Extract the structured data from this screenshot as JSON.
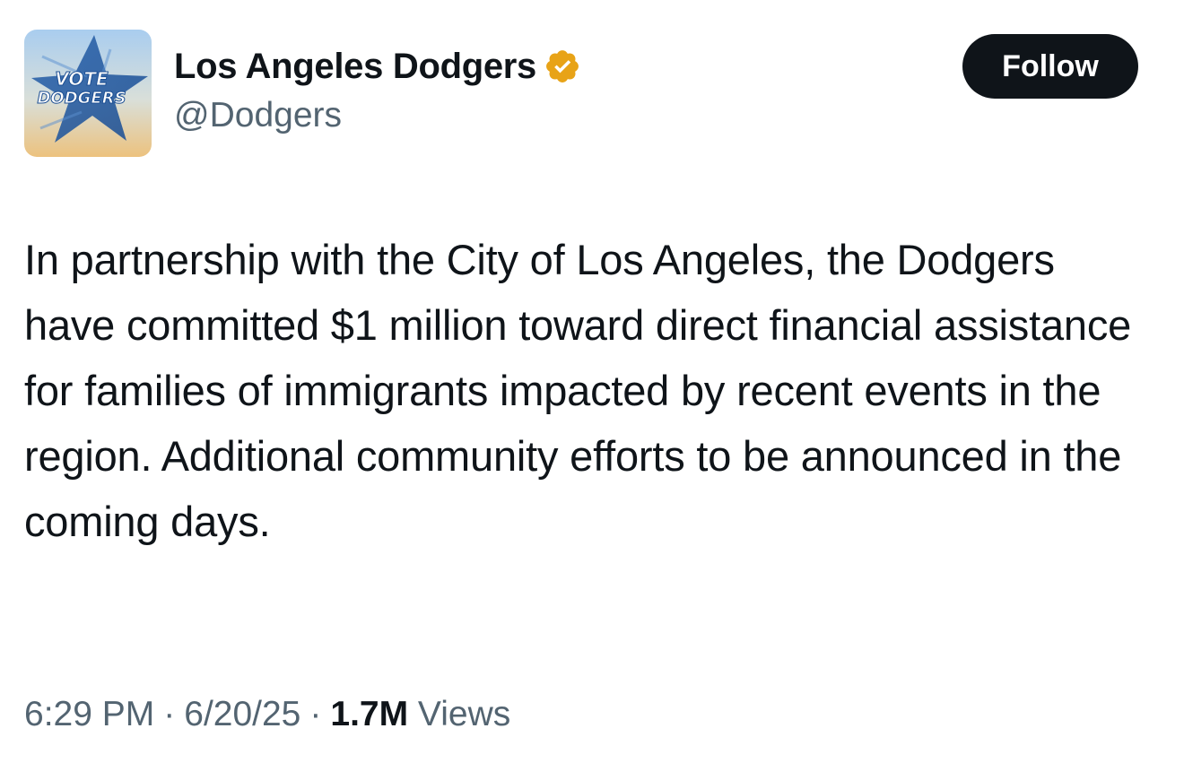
{
  "author": {
    "display_name": "Los Angeles Dodgers",
    "handle": "@Dodgers",
    "verified": true,
    "verified_badge_color": "#e8a317",
    "avatar": {
      "line1": "VOTE",
      "line2": "DODGERS",
      "colors": [
        "#2f6db5",
        "#e9c98a",
        "#7fb0e0"
      ]
    }
  },
  "actions": {
    "follow_label": "Follow"
  },
  "tweet": {
    "text": "In partnership with the City of Los Angeles, the Dodgers have committed $1 million toward direct financial assistance for families of immigrants impacted by recent events in the region. Additional community efforts to be announced in the coming days."
  },
  "meta": {
    "time": "6:29 PM",
    "separator": "·",
    "date": "6/20/25",
    "views_count": "1.7M",
    "views_label": "Views"
  }
}
